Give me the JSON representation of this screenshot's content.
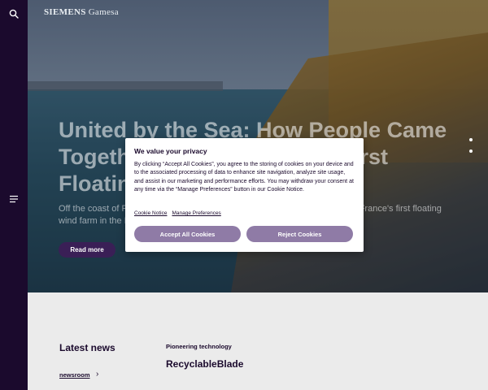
{
  "brand": {
    "logo_primary": "SIEMENS",
    "logo_secondary": "Gamesa"
  },
  "hero": {
    "title": "United by the Sea: How People Came Together to Build France's First Floating Wind Farm",
    "lead": "Off the coast of Port-Saint-Louis-du-Rhône, a pioneering wind farm rises as France's first floating wind farm in the Mediterranean Sea.",
    "cta_label": "Read more",
    "slide_count": 3
  },
  "lower": {
    "latest_news_heading": "Latest news",
    "newsroom_link": "newsroom",
    "newsroom_arrow": "›",
    "category": "Pioneering technology",
    "headline": "RecyclableBlade"
  },
  "cookie_modal": {
    "title": "We value your privacy",
    "body": "By clicking “Accept All Cookies”, you agree to the storing of cookies on your device and to the associated processing of data to enhance site navigation, analyze site usage, and assist in our marketing and performance efforts. You may withdraw your consent at any time via the “Manage Preferences” button in our Cookie Notice.",
    "cookie_notice_link": "Cookie Notice",
    "manage_preferences_link": "Manage Preferences",
    "accept_label": "Accept All Cookies",
    "reject_label": "Reject Cookies"
  },
  "icons": {
    "search": "search-icon",
    "menu": "hamburger-menu-icon"
  },
  "colors": {
    "sidebar": "#1b0a2d",
    "button_purple": "#8f7ba6",
    "read_more_bg": "#3a1f56",
    "page_bg": "#ebebeb"
  }
}
